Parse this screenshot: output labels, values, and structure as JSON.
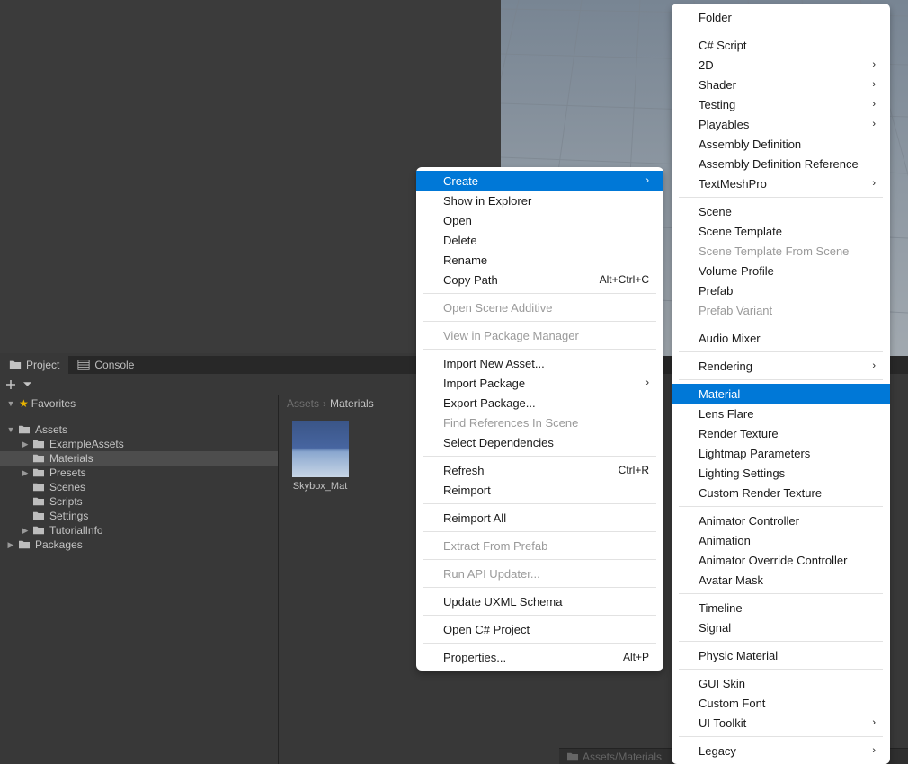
{
  "tabs": {
    "project": "Project",
    "console": "Console"
  },
  "sidebar": {
    "favorites": "Favorites",
    "items": [
      {
        "label": "Assets",
        "depth": 0,
        "expanded": true
      },
      {
        "label": "ExampleAssets",
        "depth": 1,
        "expandable": true
      },
      {
        "label": "Materials",
        "depth": 1,
        "selected": true
      },
      {
        "label": "Presets",
        "depth": 1,
        "expandable": true
      },
      {
        "label": "Scenes",
        "depth": 1
      },
      {
        "label": "Scripts",
        "depth": 1
      },
      {
        "label": "Settings",
        "depth": 1
      },
      {
        "label": "TutorialInfo",
        "depth": 1,
        "expandable": true
      },
      {
        "label": "Packages",
        "depth": 0,
        "expandable": true
      }
    ]
  },
  "breadcrumb": {
    "root": "Assets",
    "current": "Materials"
  },
  "assets": {
    "items": [
      {
        "label": "Skybox_Mat"
      }
    ]
  },
  "statusbar": {
    "path": "Assets/Materials"
  },
  "context_menu": {
    "items": [
      {
        "label": "Create",
        "submenu": true,
        "highlighted": true
      },
      {
        "label": "Show in Explorer"
      },
      {
        "label": "Open"
      },
      {
        "label": "Delete"
      },
      {
        "label": "Rename"
      },
      {
        "label": "Copy Path",
        "shortcut": "Alt+Ctrl+C"
      },
      {
        "sep": true
      },
      {
        "label": "Open Scene Additive",
        "disabled": true
      },
      {
        "sep": true
      },
      {
        "label": "View in Package Manager",
        "disabled": true
      },
      {
        "sep": true
      },
      {
        "label": "Import New Asset..."
      },
      {
        "label": "Import Package",
        "submenu": true
      },
      {
        "label": "Export Package..."
      },
      {
        "label": "Find References In Scene",
        "disabled": true
      },
      {
        "label": "Select Dependencies"
      },
      {
        "sep": true
      },
      {
        "label": "Refresh",
        "shortcut": "Ctrl+R"
      },
      {
        "label": "Reimport"
      },
      {
        "sep": true
      },
      {
        "label": "Reimport All"
      },
      {
        "sep": true
      },
      {
        "label": "Extract From Prefab",
        "disabled": true
      },
      {
        "sep": true
      },
      {
        "label": "Run API Updater...",
        "disabled": true
      },
      {
        "sep": true
      },
      {
        "label": "Update UXML Schema"
      },
      {
        "sep": true
      },
      {
        "label": "Open C# Project"
      },
      {
        "sep": true
      },
      {
        "label": "Properties...",
        "shortcut": "Alt+P"
      }
    ]
  },
  "create_submenu": {
    "items": [
      {
        "label": "Folder"
      },
      {
        "sep": true
      },
      {
        "label": "C# Script"
      },
      {
        "label": "2D",
        "submenu": true
      },
      {
        "label": "Shader",
        "submenu": true
      },
      {
        "label": "Testing",
        "submenu": true
      },
      {
        "label": "Playables",
        "submenu": true
      },
      {
        "label": "Assembly Definition"
      },
      {
        "label": "Assembly Definition Reference"
      },
      {
        "label": "TextMeshPro",
        "submenu": true
      },
      {
        "sep": true
      },
      {
        "label": "Scene"
      },
      {
        "label": "Scene Template"
      },
      {
        "label": "Scene Template From Scene",
        "disabled": true
      },
      {
        "label": "Volume Profile"
      },
      {
        "label": "Prefab"
      },
      {
        "label": "Prefab Variant",
        "disabled": true
      },
      {
        "sep": true
      },
      {
        "label": "Audio Mixer"
      },
      {
        "sep": true
      },
      {
        "label": "Rendering",
        "submenu": true
      },
      {
        "sep": true
      },
      {
        "label": "Material",
        "highlighted": true
      },
      {
        "label": "Lens Flare"
      },
      {
        "label": "Render Texture"
      },
      {
        "label": "Lightmap Parameters"
      },
      {
        "label": "Lighting Settings"
      },
      {
        "label": "Custom Render Texture"
      },
      {
        "sep": true
      },
      {
        "label": "Animator Controller"
      },
      {
        "label": "Animation"
      },
      {
        "label": "Animator Override Controller"
      },
      {
        "label": "Avatar Mask"
      },
      {
        "sep": true
      },
      {
        "label": "Timeline"
      },
      {
        "label": "Signal"
      },
      {
        "sep": true
      },
      {
        "label": "Physic Material"
      },
      {
        "sep": true
      },
      {
        "label": "GUI Skin"
      },
      {
        "label": "Custom Font"
      },
      {
        "label": "UI Toolkit",
        "submenu": true
      },
      {
        "sep": true
      },
      {
        "label": "Legacy",
        "submenu": true
      }
    ]
  }
}
